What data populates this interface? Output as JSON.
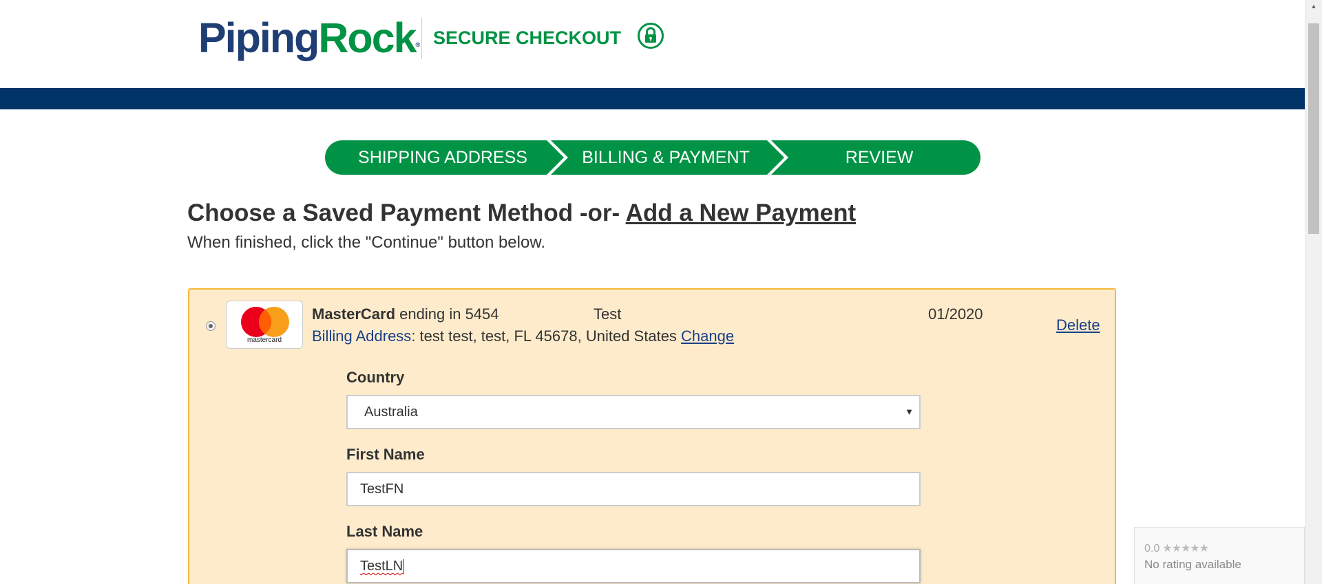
{
  "header": {
    "logo_part1": "Piping",
    "logo_part2": "Rock",
    "logo_tm": "®",
    "secure_checkout": "SECURE CHECKOUT",
    "lock_icon": "lock-icon"
  },
  "steps": [
    {
      "label": "SHIPPING ADDRESS"
    },
    {
      "label": "BILLING & PAYMENT"
    },
    {
      "label": "REVIEW"
    }
  ],
  "heading": {
    "prefix": "Choose a Saved Payment Method -or- ",
    "link": "Add a New Payment",
    "subtext": "When finished, click the \"Continue\" button below."
  },
  "payment": {
    "selected": true,
    "card_brand": "MasterCard",
    "card_logo_text": "mastercard",
    "ending_text": " ending in 5454",
    "holder": "Test",
    "expiry": "01/2020",
    "delete_label": "Delete",
    "billing_label": "Billing Address",
    "billing_address": ": test test, test, FL 45678, United States ",
    "change_label": "Change"
  },
  "form": {
    "country_label": "Country",
    "country_value": "Australia",
    "first_name_label": "First Name",
    "first_name_value": "TestFN",
    "last_name_label": "Last Name",
    "last_name_value": "TestLN"
  },
  "rating": {
    "score": "0.0",
    "stars": "★★★★★",
    "text": "No rating available"
  },
  "colors": {
    "brand_blue": "#1f3f74",
    "brand_green": "#009345",
    "band_blue": "#003366",
    "card_bg": "#fdebcb",
    "card_border": "#f6b93b",
    "link_blue": "#1a3f8a"
  }
}
